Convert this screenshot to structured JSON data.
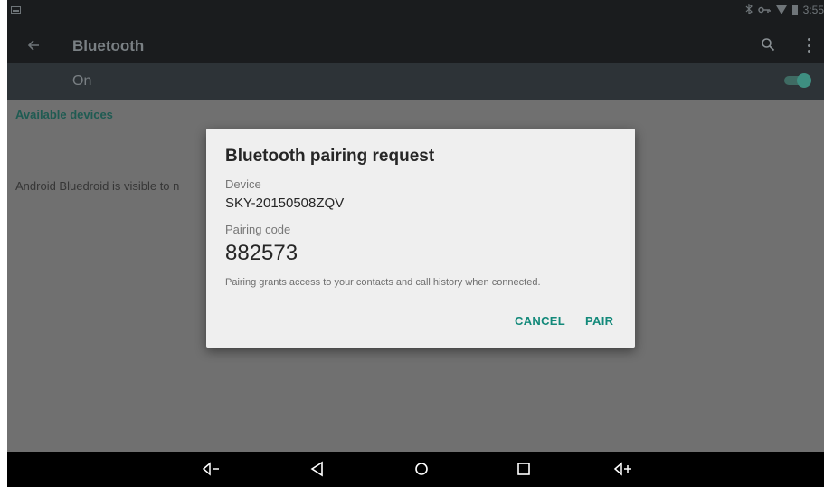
{
  "status_bar": {
    "time": "3:55",
    "icons": [
      "screenshot-icon",
      "bluetooth-icon",
      "vpn-key-icon",
      "wifi-icon",
      "battery-icon"
    ]
  },
  "action_bar": {
    "title": "Bluetooth",
    "back_icon": "back-arrow-icon",
    "search_icon": "search-icon",
    "overflow_icon": "overflow-menu-icon"
  },
  "switch_bar": {
    "label": "On",
    "toggle_on": true
  },
  "content": {
    "section_header": "Available devices",
    "visible_text": "Android Bluedroid is visible to n"
  },
  "dialog": {
    "title": "Bluetooth pairing request",
    "device_label": "Device",
    "device_value": "SKY-20150508ZQV",
    "code_label": "Pairing code",
    "code_value": "882573",
    "note": "Pairing grants access to your contacts and call history when connected.",
    "cancel_label": "CANCEL",
    "pair_label": "PAIR"
  },
  "nav_bar": {
    "buttons": [
      "volume-down-icon",
      "back-icon",
      "home-icon",
      "recents-icon",
      "volume-up-icon"
    ]
  },
  "colors": {
    "accent": "#13897a",
    "status_bar": "#1a1c1e",
    "switch_bar": "#2d3337",
    "dim_background": "#707070",
    "dialog_background": "#efefef"
  }
}
